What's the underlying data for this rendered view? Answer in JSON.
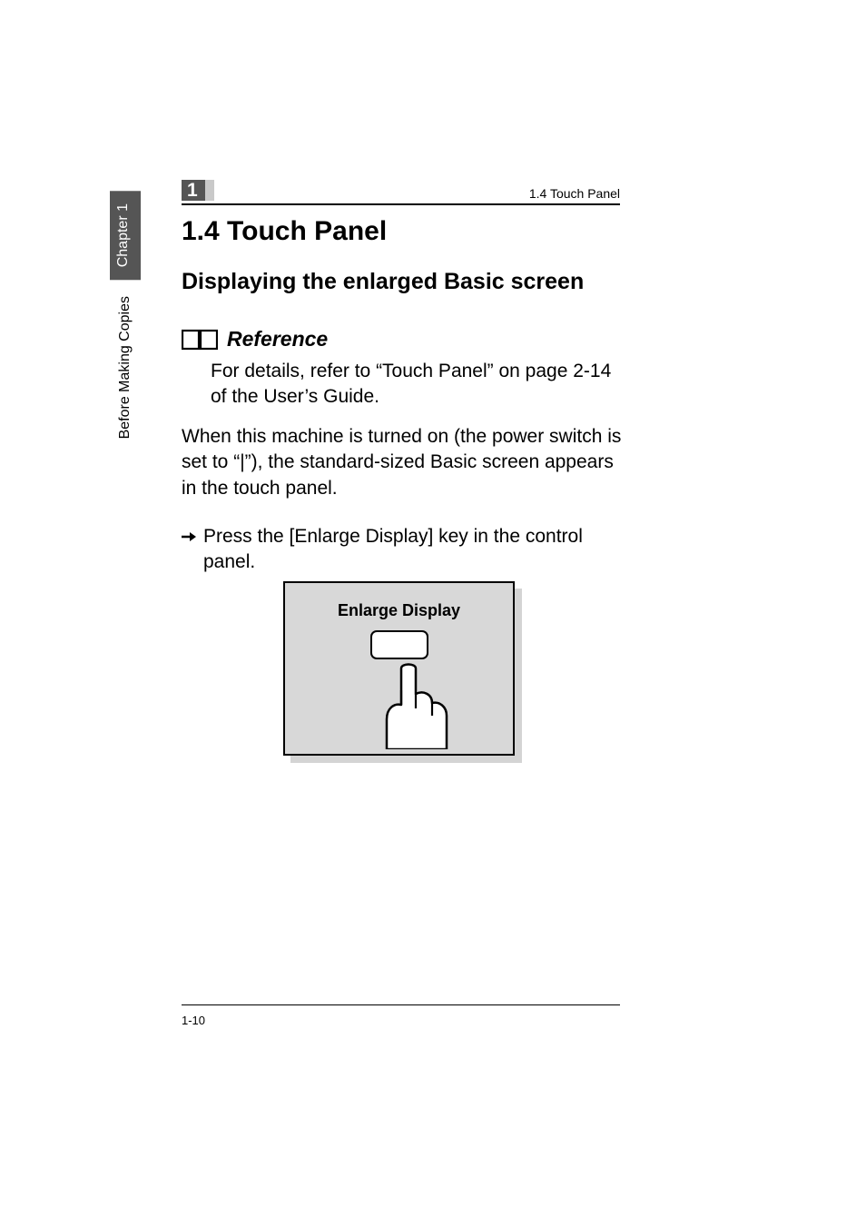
{
  "sidebar": {
    "chapter_tab": "Chapter 1",
    "section_tab": "Before Making Copies"
  },
  "header": {
    "chapter_badge": "1",
    "running_header": "1.4 Touch Panel"
  },
  "section": {
    "title": "1.4  Touch Panel",
    "subsection_title": "Displaying the enlarged Basic screen"
  },
  "reference": {
    "label": "Reference",
    "body": "For details, refer to “Touch Panel” on page 2-14 of the User’s Guide."
  },
  "body_paragraph": "When this machine is turned on (the power switch is set to “|”), the standard-sized Basic screen appears in the touch panel.",
  "step": {
    "text": "Press the [Enlarge Display] key in the control panel."
  },
  "figure": {
    "title": "Enlarge Display"
  },
  "footer": {
    "page_number": "1-10"
  }
}
